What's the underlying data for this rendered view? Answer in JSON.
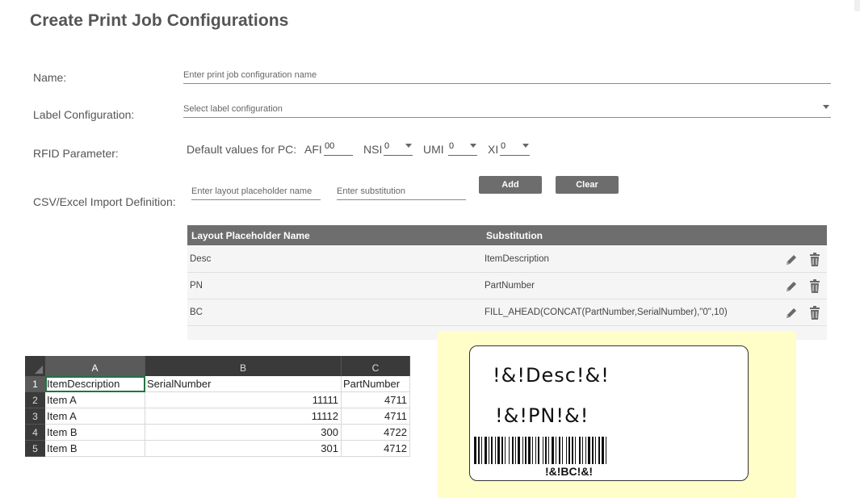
{
  "page": {
    "title": "Create Print Job Configurations"
  },
  "form": {
    "name_label": "Name:",
    "name_placeholder": "Enter print job configuration name",
    "label_config_label": "Label Configuration:",
    "label_config_placeholder": "Select label configuration",
    "rfid_label": "RFID Parameter:",
    "rfid": {
      "default_values_label": "Default values for PC:",
      "afi_label": "AFI",
      "afi_value": "00",
      "nsi_label": "NSI",
      "nsi_value": "0",
      "umi_label": "UMI",
      "umi_value": "0",
      "xi_label": "XI",
      "xi_value": "0"
    },
    "csv_label": "CSV/Excel Import Definition:",
    "placeholder_name_placeholder": "Enter layout placeholder name",
    "substitution_placeholder": "Enter substitution",
    "add_label": "Add",
    "clear_label": "Clear"
  },
  "mapping_table": {
    "headers": [
      "Layout Placeholder Name",
      "Substitution"
    ],
    "rows": [
      {
        "name": "Desc",
        "substitution": "ItemDescription"
      },
      {
        "name": "PN",
        "substitution": "PartNumber"
      },
      {
        "name": "BC",
        "substitution": "FILL_AHEAD(CONCAT(PartNumber,SerialNumber),\"0\",10)"
      }
    ],
    "edit_icon": "pencil-icon",
    "delete_icon": "trash-icon"
  },
  "spreadsheet": {
    "columns": [
      "A",
      "B",
      "C"
    ],
    "row_numbers": [
      "1",
      "2",
      "3",
      "4",
      "5"
    ],
    "rows": [
      [
        "ItemDescription",
        "SerialNumber",
        "PartNumber"
      ],
      [
        "Item A",
        "11111",
        "4711"
      ],
      [
        "Item A",
        "11112",
        "4711"
      ],
      [
        "Item B",
        "300",
        "4722"
      ],
      [
        "Item B",
        "301",
        "4712"
      ]
    ]
  },
  "label_preview": {
    "desc_text": "!&!Desc!&!",
    "pn_text": "!&!PN!&!",
    "barcode_text": "!&!BC!&!",
    "background_color": "#fffdc8"
  }
}
